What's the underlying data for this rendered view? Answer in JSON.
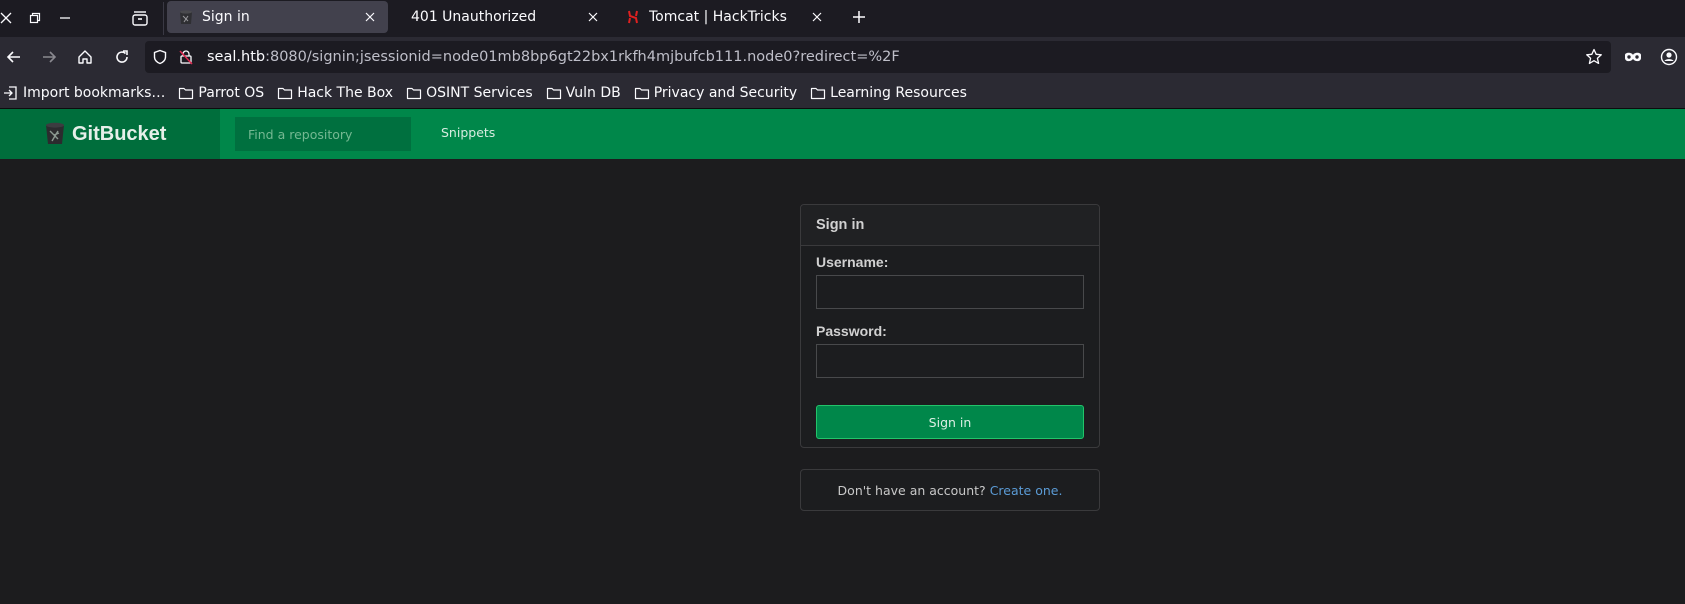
{
  "browser": {
    "tabs": [
      {
        "label": "Sign in",
        "favicon": "gitbucket-icon",
        "active": true
      },
      {
        "label": "401 Unauthorized",
        "favicon": "",
        "active": false
      },
      {
        "label": "Tomcat | HackTricks",
        "favicon": "hacktricks-icon",
        "active": false
      }
    ],
    "url": {
      "host": "seal.htb",
      "rest": ":8080/signin;jsessionid=node01mb8bp6gt22bx1rkfh4mjbufcb111.node0?redirect=%2F"
    },
    "bookmarks": [
      {
        "label": "Import bookmarks…",
        "icon": "import-icon"
      },
      {
        "label": "Parrot OS",
        "icon": "folder-icon"
      },
      {
        "label": "Hack The Box",
        "icon": "folder-icon"
      },
      {
        "label": "OSINT Services",
        "icon": "folder-icon"
      },
      {
        "label": "Vuln DB",
        "icon": "folder-icon"
      },
      {
        "label": "Privacy and Security",
        "icon": "folder-icon"
      },
      {
        "label": "Learning Resources",
        "icon": "folder-icon"
      }
    ]
  },
  "gitbucket": {
    "brand": "GitBucket",
    "search_placeholder": "Find a repository",
    "nav": {
      "snippets": "Snippets"
    },
    "colors": {
      "header": "#00874a",
      "brand_bg": "#006e3c",
      "link": "#5b9bd5"
    }
  },
  "signin": {
    "title": "Sign in",
    "username_label": "Username:",
    "username_value": "",
    "password_label": "Password:",
    "password_value": "",
    "submit_label": "Sign in"
  },
  "signup": {
    "prompt": "Don't have an account?",
    "link": "Create one."
  }
}
